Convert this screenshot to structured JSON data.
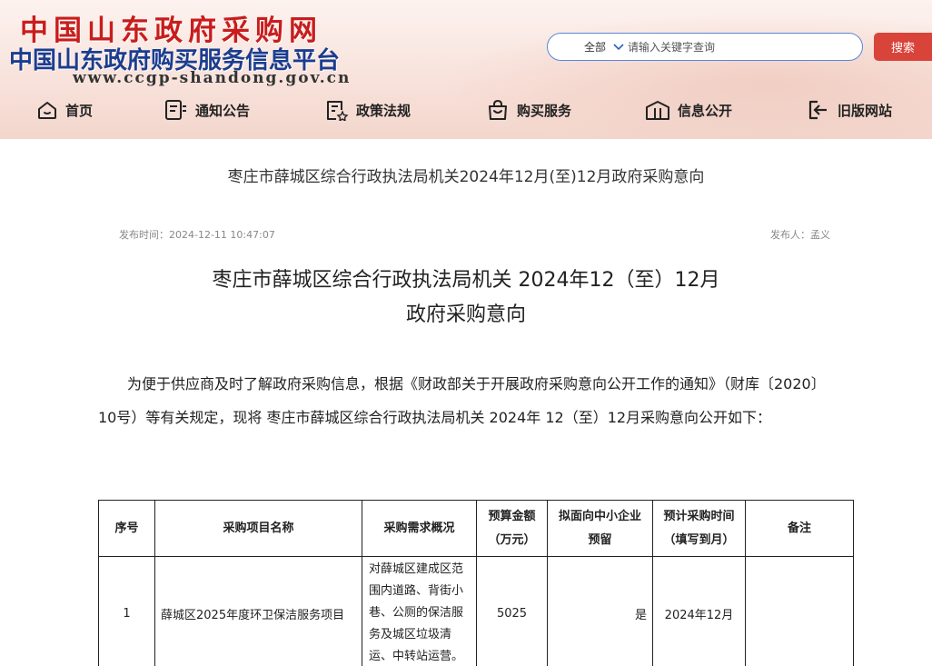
{
  "header": {
    "logo_line1": "中国山东政府采购网",
    "logo_line2": "中国山东政府购买服务信息平台",
    "logo_line3": "www.ccgp-shandong.gov.cn",
    "search": {
      "scope": "全部",
      "placeholder": "请输入关键字查询",
      "button": "搜索"
    },
    "nav": [
      {
        "label": "首页",
        "icon": "home-icon"
      },
      {
        "label": "通知公告",
        "icon": "notice-icon"
      },
      {
        "label": "政策法规",
        "icon": "policy-icon"
      },
      {
        "label": "购买服务",
        "icon": "shopping-bag-icon"
      },
      {
        "label": "信息公开",
        "icon": "building-icon"
      },
      {
        "label": "旧版网站",
        "icon": "exit-icon"
      }
    ],
    "colors": {
      "logo_red": "#c81d1d",
      "logo_blue": "#1b3d8f",
      "search_button": "#d9443a",
      "search_border": "#5a86d9"
    }
  },
  "article": {
    "page_title": "枣庄市薛城区综合行政执法局机关2024年12月(至)12月政府采购意向",
    "publish_time": "发布时间：2024-12-11 10:47:07",
    "publisher": "发布人：孟义",
    "doc_title_line1": "枣庄市薛城区综合行政执法局机关 2024年12（至）12月",
    "doc_title_line2": "政府采购意向",
    "intro": "为便于供应商及时了解政府采购信息，根据《财政部关于开展政府采购意向公开工作的通知》（财库〔2020〕10号）等有关规定，现将 枣庄市薛城区综合行政执法局机关   2024年 12（至）12月采购意向公开如下："
  },
  "table": {
    "headers": {
      "seq": "序号",
      "name": "采购项目名称",
      "desc": "采购需求概况",
      "budget_l1": "预算金额",
      "budget_l2": "（万元）",
      "sme_l1": "拟面向中小企业",
      "sme_l2": "预留",
      "time_l1": "预计采购时间",
      "time_l2": "（填写到月）",
      "remark": "备注"
    },
    "rows": [
      {
        "seq": "1",
        "name": "薛城区2025年度环卫保洁服务项目",
        "desc": "对薛城区建成区范围内道路、背街小巷、公厕的保洁服务及城区垃圾清运、中转站运营。",
        "budget": "5025",
        "sme": "是",
        "time": "2024年12月",
        "remark": ""
      }
    ]
  }
}
